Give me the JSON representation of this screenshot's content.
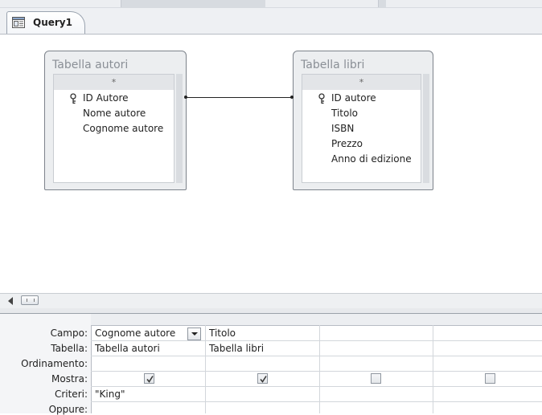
{
  "document_tab": {
    "label": "Query1",
    "icon": "query-design-icon"
  },
  "tables": [
    {
      "title": "Tabella autori",
      "star": "*",
      "fields": [
        {
          "name": "ID Autore",
          "key": true
        },
        {
          "name": "Nome autore",
          "key": false
        },
        {
          "name": "Cognome autore",
          "key": false
        }
      ]
    },
    {
      "title": "Tabella libri",
      "star": "*",
      "fields": [
        {
          "name": "ID autore",
          "key": true
        },
        {
          "name": "Titolo",
          "key": false
        },
        {
          "name": "ISBN",
          "key": false
        },
        {
          "name": "Prezzo",
          "key": false
        },
        {
          "name": "Anno di edizione",
          "key": false
        }
      ]
    }
  ],
  "grid": {
    "row_labels": [
      "Campo:",
      "Tabella:",
      "Ordinamento:",
      "Mostra:",
      "Criteri:",
      "Oppure:"
    ],
    "columns": [
      {
        "campo": "Cognome autore",
        "tabella": "Tabella autori",
        "ordinamento": "",
        "mostra": true,
        "criteri": "\"King\"",
        "oppure": ""
      },
      {
        "campo": "Titolo",
        "tabella": "Tabella libri",
        "ordinamento": "",
        "mostra": true,
        "criteri": "",
        "oppure": ""
      },
      {
        "campo": "",
        "tabella": "",
        "ordinamento": "",
        "mostra": false,
        "criteri": "",
        "oppure": ""
      },
      {
        "campo": "",
        "tabella": "",
        "ordinamento": "",
        "mostra": false,
        "criteri": "",
        "oppure": ""
      }
    ]
  },
  "colors": {
    "frame": "#eef0f3",
    "border": "#7d838b",
    "check": "#3a3a3a"
  }
}
